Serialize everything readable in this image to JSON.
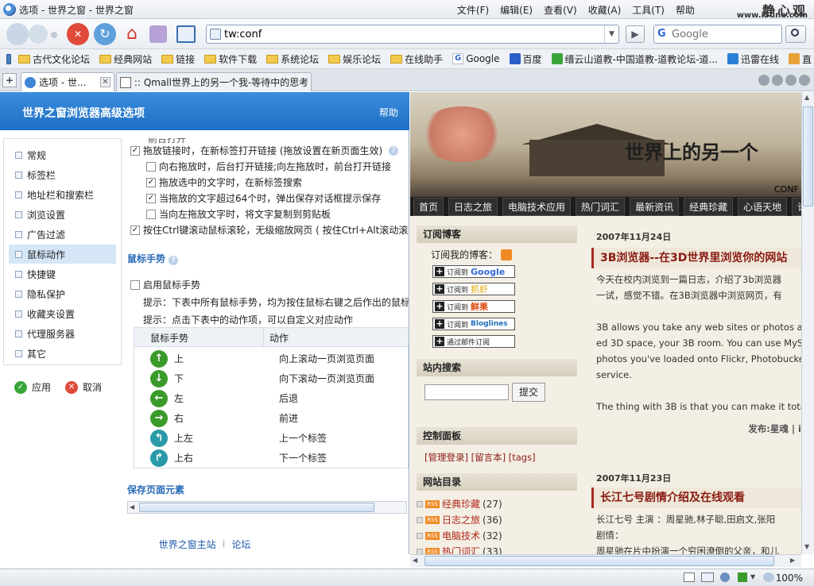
{
  "window": {
    "title": "选项 - 世界之窗 - 世界之窗"
  },
  "menu": [
    "文件(F)",
    "编辑(E)",
    "查看(V)",
    "收藏(A)",
    "工具(T)",
    "帮助"
  ],
  "watermark": {
    "name": "静心观",
    "url": "www.i5une.com"
  },
  "address": {
    "value": "tw:conf"
  },
  "search": {
    "placeholder": "Google",
    "engine_icon": "G"
  },
  "bookmarks": [
    {
      "label": "古代文化论坛",
      "icon": "folder"
    },
    {
      "label": "经典网站",
      "icon": "folder"
    },
    {
      "label": "链接",
      "icon": "folder"
    },
    {
      "label": "软件下载",
      "icon": "folder"
    },
    {
      "label": "系统论坛",
      "icon": "folder"
    },
    {
      "label": "娱乐论坛",
      "icon": "folder"
    },
    {
      "label": "在线助手",
      "icon": "folder"
    },
    {
      "label": "Google",
      "icon": "google"
    },
    {
      "label": "百度",
      "icon": "baidu"
    },
    {
      "label": "缙云山道教-中国道教-道教论坛-道...",
      "icon": "page"
    },
    {
      "label": "迅雷在线",
      "icon": "page"
    },
    {
      "label": "直",
      "icon": "page"
    }
  ],
  "tabs": [
    {
      "label": "选项 - 世...",
      "active": true
    },
    {
      "label": ":: Qmall世界上的另一个我-等待中的思考",
      "active": false
    }
  ],
  "options": {
    "header": "世界之窗浏览器高级选项",
    "help": "帮助",
    "nav": [
      "常规",
      "标签栏",
      "地址栏和搜索栏",
      "浏览设置",
      "广告过滤",
      "鼠标动作",
      "快捷键",
      "隐私保护",
      "收藏夹设置",
      "代理服务器",
      "其它"
    ],
    "selected_nav": "鼠标动作",
    "apply": "应用",
    "cancel": "取消",
    "cut_text": "前台打开",
    "settings": [
      {
        "label": "拖放链接时，在新标签打开链接 (拖放设置在新页面生效)",
        "checked": true
      },
      {
        "label": "向右拖放时，后台打开链接;向左拖放时，前台打开链接",
        "checked": false
      },
      {
        "label": "拖放选中的文字时，在新标签搜索",
        "checked": true
      },
      {
        "label": "当拖放的文字超过64个时，弹出保存对话框提示保存",
        "checked": true
      },
      {
        "label": "当向左拖放文字时，将文字复制到剪贴板",
        "checked": false
      },
      {
        "label": "按住Ctrl键滚动鼠标滚轮，无级缩放网页 ( 按住Ctrl+Alt滚动滚",
        "checked": true
      }
    ],
    "gesture_section": "鼠标手势",
    "enable_gesture": {
      "label": "启用鼠标手势",
      "checked": false
    },
    "hint1": "提示：下表中所有鼠标手势，均为按住鼠标右键之后作出的鼠标",
    "hint2": "提示：点击下表中的动作项，可以自定义对应动作",
    "table_headers": [
      "鼠标手势",
      "动作"
    ],
    "gestures": [
      {
        "gesture": "上",
        "action": "向上滚动一页浏览页面",
        "icon": "arrow-up-icon",
        "color": "#3a9a2a"
      },
      {
        "gesture": "下",
        "action": "向下滚动一页浏览页面",
        "icon": "arrow-down-icon",
        "color": "#3a9a2a"
      },
      {
        "gesture": "左",
        "action": "后退",
        "icon": "arrow-left-icon",
        "color": "#3a9a2a"
      },
      {
        "gesture": "右",
        "action": "前进",
        "icon": "arrow-right-icon",
        "color": "#3a9a2a"
      },
      {
        "gesture": "上左",
        "action": "上一个标签",
        "icon": "arrow-up-left-icon",
        "color": "#2a9aa8"
      },
      {
        "gesture": "上右",
        "action": "下一个标签",
        "icon": "arrow-up-right-icon",
        "color": "#2a9aa8"
      }
    ],
    "save_section": "保存页面元素",
    "footer_links": [
      "世界之窗主站",
      "论坛"
    ],
    "footer_sep": "⁞"
  },
  "blog": {
    "banner_title": "世界上的另一个",
    "banner_sub": "CONF",
    "nav": [
      "首页",
      "日志之旅",
      "电脑技术应用",
      "热门词汇",
      "最新资讯",
      "经典珍藏",
      "心语天地",
      "论"
    ],
    "subscribe": {
      "title": "订阅博客",
      "label": "订阅我的博客：",
      "buttons": [
        {
          "prefix": "订阅到",
          "name": "Google",
          "color": "#3367d6"
        },
        {
          "prefix": "订阅到",
          "name": "抓虾",
          "color": "#e0a800"
        },
        {
          "prefix": "订阅到",
          "name": "鲜果",
          "color": "#d9480f"
        },
        {
          "prefix": "订阅到",
          "name": "Bloglines",
          "color": "#1f6fb8"
        },
        {
          "prefix": "通过邮件订阅",
          "name": "",
          "color": "#222"
        }
      ]
    },
    "site_search": {
      "title": "站内搜索",
      "button": "提交"
    },
    "control": {
      "title": "控制面板",
      "links": "[管理登录] [留言本] [tags]"
    },
    "directory": {
      "title": "网站目录",
      "items": [
        {
          "name": "经典珍藏",
          "count": "(27)"
        },
        {
          "name": "日志之旅",
          "count": "(36)"
        },
        {
          "name": "电脑技术",
          "count": "(32)"
        },
        {
          "name": "热门词汇",
          "count": "(33)"
        }
      ]
    },
    "posts": [
      {
        "date": "2007年11月24日",
        "title": "3B浏览器--在3D世界里浏览你的网站",
        "lines": [
          "今天在校内浏览到一篇日志，介绍了3b浏览器",
          "一试，感觉不错。在3B浏览器中浏览网页，有",
          "",
          "3B allows you take any web sites or photos and",
          "ed 3D space, your 3B room. You can use MySpa",
          "photos you've loaded onto Flickr, Photobucket o",
          "service.",
          "",
          "The thing with 3B is that you can make it totally"
        ],
        "meta": "发布:星魂  |  i"
      },
      {
        "date": "2007年11月23日",
        "title": "长江七号剧情介绍及在线观看",
        "lines": [
          "长江七号  主演 ：周星驰,林子聪,田启文,张阳",
          "剧情：",
          "周星驰在片中扮演一个穷困潦倒的父亲，和儿"
        ]
      }
    ]
  },
  "status": {
    "zoom": "100%"
  }
}
